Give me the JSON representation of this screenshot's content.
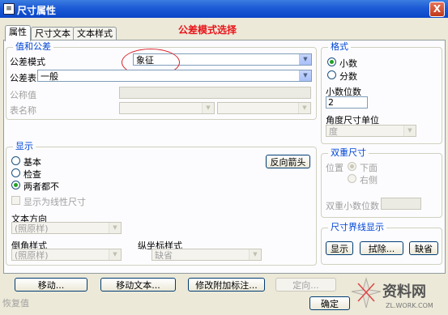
{
  "window": {
    "title": "尺寸属性",
    "icon": "dialog-icon",
    "close_label": "X"
  },
  "annotation": "公差模式选择",
  "tabs": [
    {
      "label": "属性",
      "active": true
    },
    {
      "label": "尺寸文本",
      "active": false
    },
    {
      "label": "文本样式",
      "active": false
    }
  ],
  "tolerance_group": {
    "legend": "值和公差",
    "mode_label": "公差模式",
    "mode_value": "象征",
    "table_label": "公差表",
    "table_value": "一般",
    "nominal_label": "公称值",
    "table_name_label": "表名称"
  },
  "format_group": {
    "legend": "格式",
    "decimal": "小数",
    "fraction": "分数",
    "places_label": "小数位数",
    "places_value": "2",
    "angle_label": "角度尺寸单位",
    "angle_value": "度"
  },
  "display_group": {
    "legend": "显示",
    "basic": "基本",
    "inspect": "检查",
    "neither": "两者都不",
    "flip_arrows": "反向箭头",
    "linear_check": "显示为线性尺寸",
    "text_dir_label": "文本方向",
    "text_dir_value": "(照原样)",
    "chamfer_label": "倒角样式",
    "chamfer_value": "(照原样)",
    "ordinate_label": "纵坐标样式",
    "ordinate_value": "缺省"
  },
  "dual_group": {
    "legend": "双重尺寸",
    "position_label": "位置",
    "below": "下面",
    "right": "右侧",
    "dual_places_label": "双重小数位数"
  },
  "witness_group": {
    "legend": "尺寸界线显示",
    "show": "显示",
    "erase": "拭除...",
    "default": "缺省"
  },
  "bottom_buttons": {
    "move": "移动...",
    "move_text": "移动文本...",
    "edit_attach": "修改附加标注...",
    "orient": "定向..."
  },
  "footer": {
    "restore": "恢复值",
    "ok": "确定"
  },
  "watermark": {
    "text": "资料网",
    "url": "ZL.WORK.COM"
  },
  "colors": {
    "accent": "#0046d5",
    "annotation": "#e8141a",
    "title_bar": "#0a46c8"
  }
}
